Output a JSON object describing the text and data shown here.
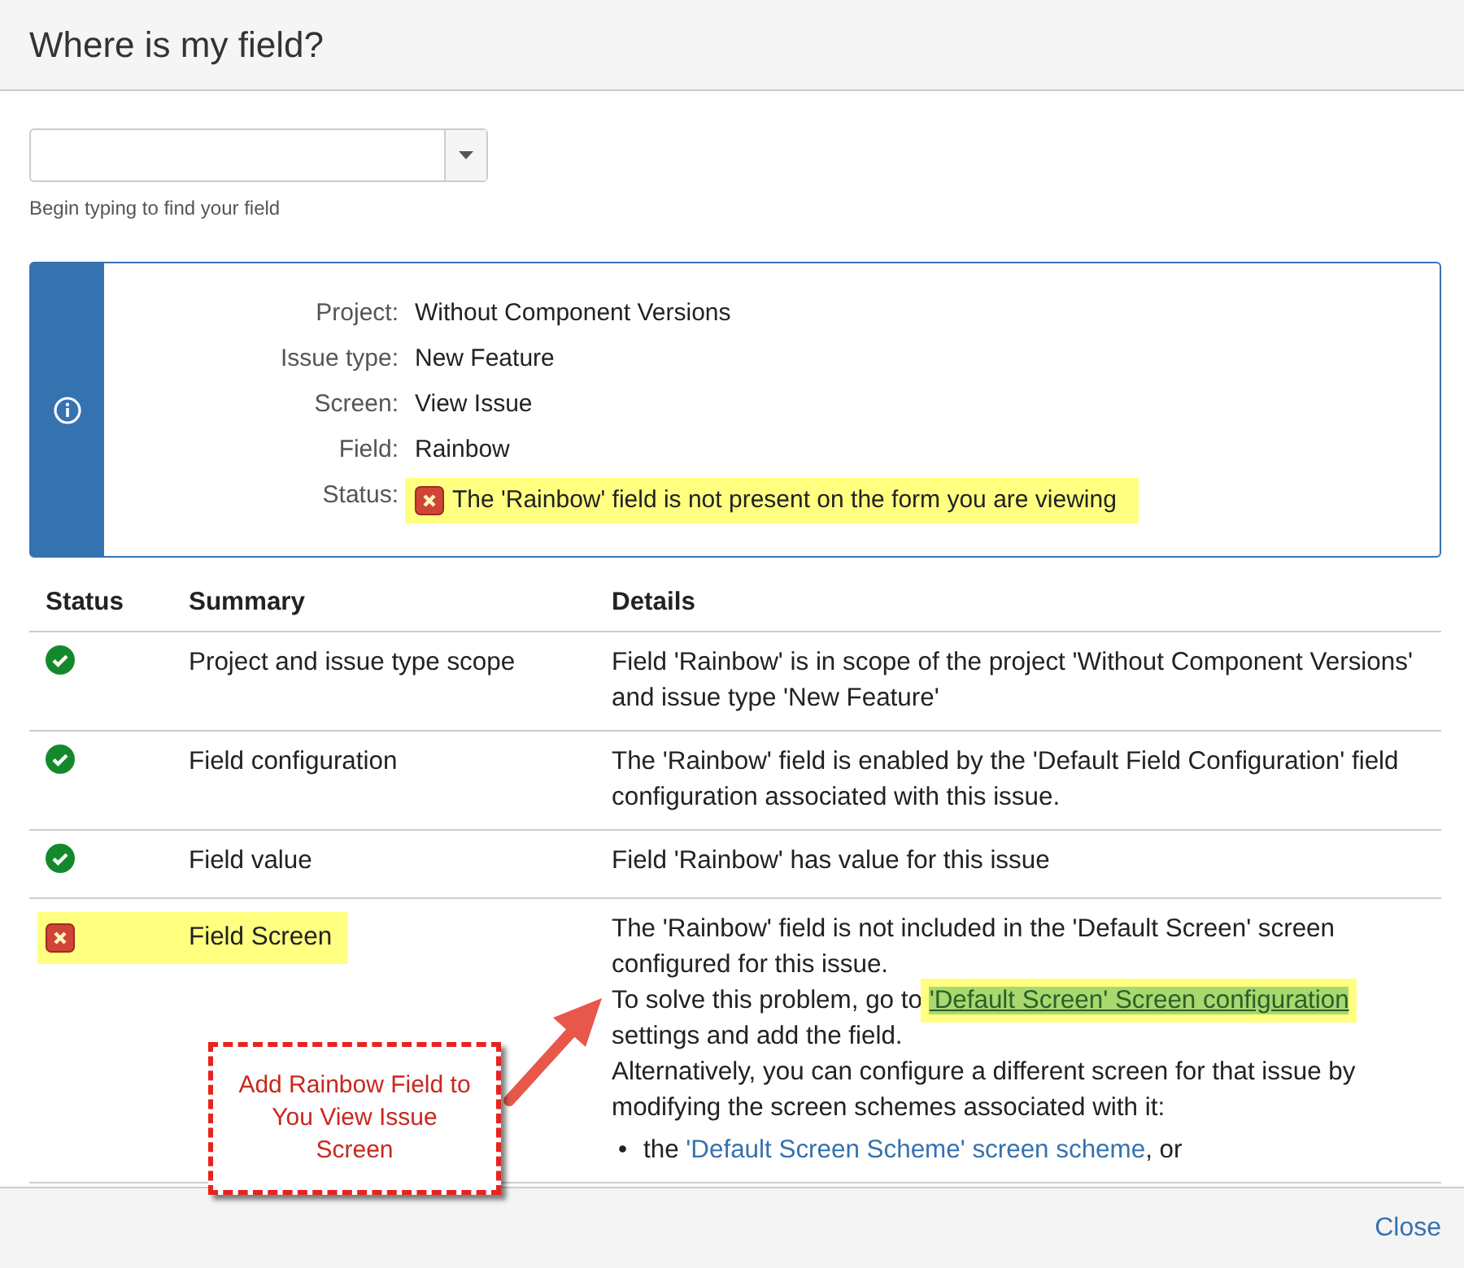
{
  "dialog": {
    "title": "Where is my field?",
    "close": "Close"
  },
  "field_search": {
    "hint": "Begin typing to find your field"
  },
  "info_panel": {
    "rows": [
      {
        "label": "Project:",
        "value": "Without Component Versions",
        "kind": "text"
      },
      {
        "label": "Issue type:",
        "value": "New Feature",
        "kind": "text"
      },
      {
        "label": "Screen:",
        "value": "View Issue",
        "kind": "text"
      },
      {
        "label": "Field:",
        "value": "Rainbow",
        "kind": "text"
      },
      {
        "label": "Status:",
        "value": "The 'Rainbow' field is not present on the form you are viewing",
        "kind": "error",
        "highlighted": true
      }
    ]
  },
  "table": {
    "columns": [
      "Status",
      "Summary",
      "Details"
    ],
    "rows": [
      {
        "kind": "ok",
        "summary": "Project and issue type scope",
        "highlighted": false,
        "details": [
          {
            "kind": "text",
            "text": "Field 'Rainbow' is in scope of the project 'Without Component Versions' and issue type 'New Feature'"
          }
        ]
      },
      {
        "kind": "ok",
        "summary": "Field configuration",
        "highlighted": false,
        "details": [
          {
            "kind": "text",
            "text": "The 'Rainbow' field is enabled by the 'Default Field Configuration' field configuration associated with this issue."
          }
        ]
      },
      {
        "kind": "ok",
        "summary": "Field value",
        "highlighted": false,
        "details": [
          {
            "kind": "text",
            "text": "Field 'Rainbow' has value for this issue"
          }
        ]
      },
      {
        "kind": "error",
        "summary": "Field Screen",
        "highlighted": true,
        "details": [
          {
            "kind": "text",
            "text": "The 'Rainbow' field is not included in the 'Default Screen' screen configured for this issue."
          },
          {
            "kind": "link",
            "before": "To solve this problem, go to",
            "link": "'Default Screen' Screen configuration",
            "after": "settings and add the field.",
            "highlighted": true
          },
          {
            "kind": "text",
            "text": "Alternatively, you can configure a different screen for that issue by modifying the screen schemes associated with it:"
          },
          {
            "kind": "bullet",
            "marker": "•",
            "before": "the",
            "link": "'Default Screen Scheme' screen scheme",
            "after": ", or",
            "highlighted": false
          }
        ]
      }
    ]
  },
  "annotation": {
    "callout": "Add Rainbow Field to You View Issue Screen"
  }
}
